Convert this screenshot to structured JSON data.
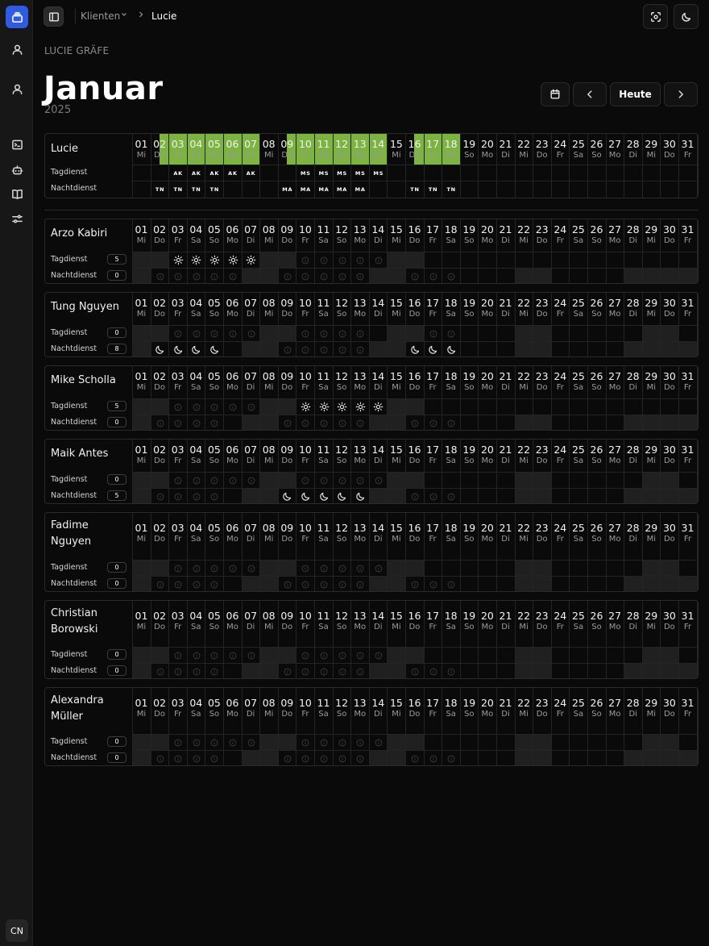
{
  "sidebar": {
    "items": [
      {
        "icon": "stack-icon",
        "active": true
      },
      {
        "icon": "user-icon"
      },
      {
        "icon": "user-icon"
      },
      {
        "icon": "terminal-icon"
      },
      {
        "icon": "bot-icon"
      },
      {
        "icon": "book-icon"
      },
      {
        "icon": "sliders-icon"
      }
    ],
    "avatar": "CN"
  },
  "breadcrumb": {
    "parent": "Klienten",
    "current": "Lucie"
  },
  "header": {
    "client_name": "LUCIE GRÄFE",
    "month": "Januar",
    "year": "2025",
    "today_label": "Heute"
  },
  "days": [
    {
      "n": "01",
      "w": "Mi"
    },
    {
      "n": "02",
      "w": "Do"
    },
    {
      "n": "03",
      "w": "Fr"
    },
    {
      "n": "04",
      "w": "Sa"
    },
    {
      "n": "05",
      "w": "So"
    },
    {
      "n": "06",
      "w": "Mo"
    },
    {
      "n": "07",
      "w": "Di"
    },
    {
      "n": "08",
      "w": "Mi"
    },
    {
      "n": "09",
      "w": "Do"
    },
    {
      "n": "10",
      "w": "Fr"
    },
    {
      "n": "11",
      "w": "Sa"
    },
    {
      "n": "12",
      "w": "So"
    },
    {
      "n": "13",
      "w": "Mo"
    },
    {
      "n": "14",
      "w": "Di"
    },
    {
      "n": "15",
      "w": "Mi"
    },
    {
      "n": "16",
      "w": "Do"
    },
    {
      "n": "17",
      "w": "Fr"
    },
    {
      "n": "18",
      "w": "Sa"
    },
    {
      "n": "19",
      "w": "So"
    },
    {
      "n": "20",
      "w": "Mo"
    },
    {
      "n": "21",
      "w": "Di"
    },
    {
      "n": "22",
      "w": "Mi"
    },
    {
      "n": "23",
      "w": "Do"
    },
    {
      "n": "24",
      "w": "Fr"
    },
    {
      "n": "25",
      "w": "Sa"
    },
    {
      "n": "26",
      "w": "So"
    },
    {
      "n": "27",
      "w": "Mo"
    },
    {
      "n": "28",
      "w": "Di"
    },
    {
      "n": "29",
      "w": "Mi"
    },
    {
      "n": "30",
      "w": "Do"
    },
    {
      "n": "31",
      "w": "Fr"
    }
  ],
  "labels": {
    "day": "Tagdienst",
    "night": "Nachtdienst"
  },
  "client": {
    "name": "Lucie",
    "coverage_days": [
      2,
      3,
      4,
      5,
      6,
      7,
      9,
      10,
      11,
      12,
      13,
      14,
      16,
      17,
      18
    ],
    "day": {
      "3": "AK",
      "4": "AK",
      "5": "AK",
      "6": "AK",
      "7": "AK",
      "10": "MS",
      "11": "MS",
      "12": "MS",
      "13": "MS",
      "14": "MS"
    },
    "night": {
      "2": "TN",
      "3": "TN",
      "4": "TN",
      "5": "TN",
      "9": "MA",
      "10": "MA",
      "11": "MA",
      "12": "MA",
      "13": "MA",
      "16": "TN",
      "17": "TN",
      "18": "TN"
    }
  },
  "caregivers": [
    {
      "name": "Arzo Kabiri",
      "day_count": "5",
      "night_count": "0",
      "day_shifts": [
        3,
        4,
        5,
        6,
        7
      ],
      "night_shifts": [],
      "day_unavail": [
        1,
        2,
        8,
        9,
        15,
        16
      ],
      "night_unavail": [
        1,
        7,
        8,
        14,
        15,
        22,
        23,
        28,
        29,
        30,
        31
      ],
      "day_avail": [
        10,
        11,
        12,
        13,
        14
      ],
      "night_avail": [
        2,
        3,
        4,
        5,
        6,
        9,
        10,
        11,
        12,
        13,
        16,
        17,
        18
      ]
    },
    {
      "name": "Tung Nguyen",
      "day_count": "0",
      "night_count": "8",
      "day_shifts": [],
      "night_shifts": [
        2,
        3,
        4,
        5,
        16,
        17,
        18
      ],
      "day_unavail": [
        1,
        2,
        8,
        9,
        15,
        16,
        22,
        23,
        29,
        30
      ],
      "night_unavail": [
        1,
        7,
        8,
        14,
        15,
        22,
        23,
        28,
        29,
        30,
        31
      ],
      "day_avail": [
        3,
        4,
        5,
        6,
        7,
        10,
        11,
        12,
        13,
        17,
        18
      ],
      "night_avail": [
        9,
        10,
        11,
        12,
        13
      ]
    },
    {
      "name": "Mike Scholla",
      "day_count": "5",
      "night_count": "0",
      "day_shifts": [
        10,
        11,
        12,
        13,
        14
      ],
      "night_shifts": [],
      "day_unavail": [
        1,
        2,
        8,
        9,
        15,
        16
      ],
      "night_unavail": [
        1,
        7,
        8,
        14,
        15,
        22,
        23,
        28,
        29,
        30,
        31
      ],
      "day_avail": [
        3,
        4,
        5,
        6,
        7
      ],
      "night_avail": [
        2,
        3,
        4,
        5,
        9,
        10,
        11,
        12,
        13,
        16,
        17,
        18
      ]
    },
    {
      "name": "Maik Antes",
      "day_count": "0",
      "night_count": "5",
      "day_shifts": [],
      "night_shifts": [
        9,
        10,
        11,
        12,
        13
      ],
      "day_unavail": [
        1,
        2,
        8,
        9,
        15,
        16,
        22,
        23,
        29,
        30
      ],
      "night_unavail": [
        1,
        7,
        8,
        14,
        15,
        22,
        23,
        28,
        29,
        30,
        31
      ],
      "day_avail": [
        3,
        4,
        5,
        6,
        7,
        10,
        11,
        12,
        13,
        14
      ],
      "night_avail": [
        2,
        3,
        4,
        5,
        16,
        17,
        18
      ]
    },
    {
      "name": "Fadime Nguyen",
      "day_count": "0",
      "night_count": "0",
      "day_shifts": [],
      "night_shifts": [],
      "day_unavail": [
        1,
        2,
        8,
        9,
        15,
        16,
        22,
        23,
        29,
        30
      ],
      "night_unavail": [
        1,
        7,
        8,
        14,
        15,
        22,
        23,
        28,
        29,
        30,
        31
      ],
      "day_avail": [
        3,
        4,
        5,
        6,
        7,
        10,
        11,
        12,
        13,
        14
      ],
      "night_avail": [
        2,
        3,
        4,
        5,
        9,
        10,
        11,
        12,
        13,
        16,
        17,
        18
      ]
    },
    {
      "name": "Christian Borowski",
      "day_count": "0",
      "night_count": "0",
      "day_shifts": [],
      "night_shifts": [],
      "day_unavail": [
        1,
        2,
        8,
        9,
        15,
        16,
        22,
        23,
        29,
        30
      ],
      "night_unavail": [
        1,
        7,
        8,
        14,
        15,
        22,
        23,
        28,
        29,
        30,
        31
      ],
      "day_avail": [
        3,
        4,
        5,
        6,
        7,
        10,
        11,
        12,
        13,
        14
      ],
      "night_avail": [
        2,
        3,
        4,
        5,
        9,
        10,
        11,
        12,
        13,
        16,
        17,
        18
      ]
    },
    {
      "name": "Alexandra Müller",
      "day_count": "0",
      "night_count": "0",
      "day_shifts": [],
      "night_shifts": [],
      "day_unavail": [
        1,
        2,
        8,
        9,
        15,
        16,
        22,
        23,
        29,
        30
      ],
      "night_unavail": [
        1,
        7,
        8,
        14,
        15,
        22,
        23,
        28,
        29,
        30,
        31
      ],
      "day_avail": [
        3,
        4,
        5,
        6,
        7,
        10,
        11,
        12,
        13,
        14
      ],
      "night_avail": [
        2,
        3,
        4,
        5,
        9,
        10,
        11,
        12,
        13,
        16,
        17,
        18
      ]
    }
  ]
}
